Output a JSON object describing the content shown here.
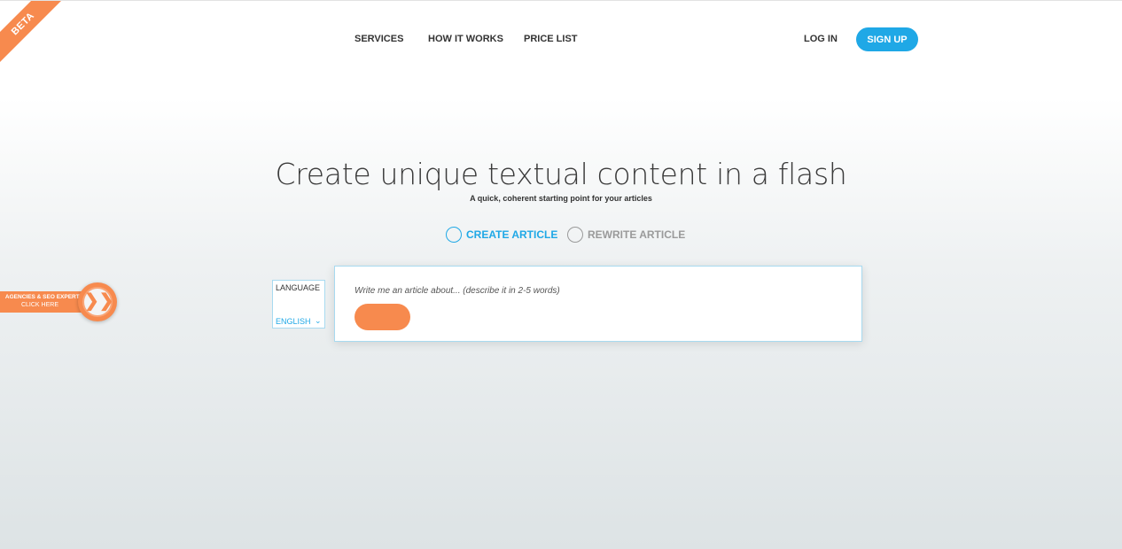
{
  "beta": {
    "label": "BETA"
  },
  "nav": {
    "services": "SERVICES",
    "how_it_works": "HOW IT WORKS",
    "price_list": "PRICE LIST",
    "login": "LOG IN",
    "signup": "SIGN UP"
  },
  "hero": {
    "title": "Create unique textual content in a flash",
    "subtitle": "A quick, coherent starting point for your articles"
  },
  "modes": {
    "create": "CREATE ARTICLE",
    "rewrite": "REWRITE ARTICLE",
    "selected": "create"
  },
  "language": {
    "label": "LANGUAGE",
    "value": "ENGLISH",
    "chevron": "⌄"
  },
  "input": {
    "placeholder": "Write me an article about... (describe it in 2-5 words)",
    "value": ""
  },
  "agency_tab": {
    "line1": "AGENCIES & SEO EXPERTS",
    "line2": "CLICK HERE",
    "icon": "❯❯"
  },
  "colors": {
    "accent_blue": "#1fa8e6",
    "accent_orange": "#f78a4e",
    "muted_gray": "#9a9a9a"
  }
}
